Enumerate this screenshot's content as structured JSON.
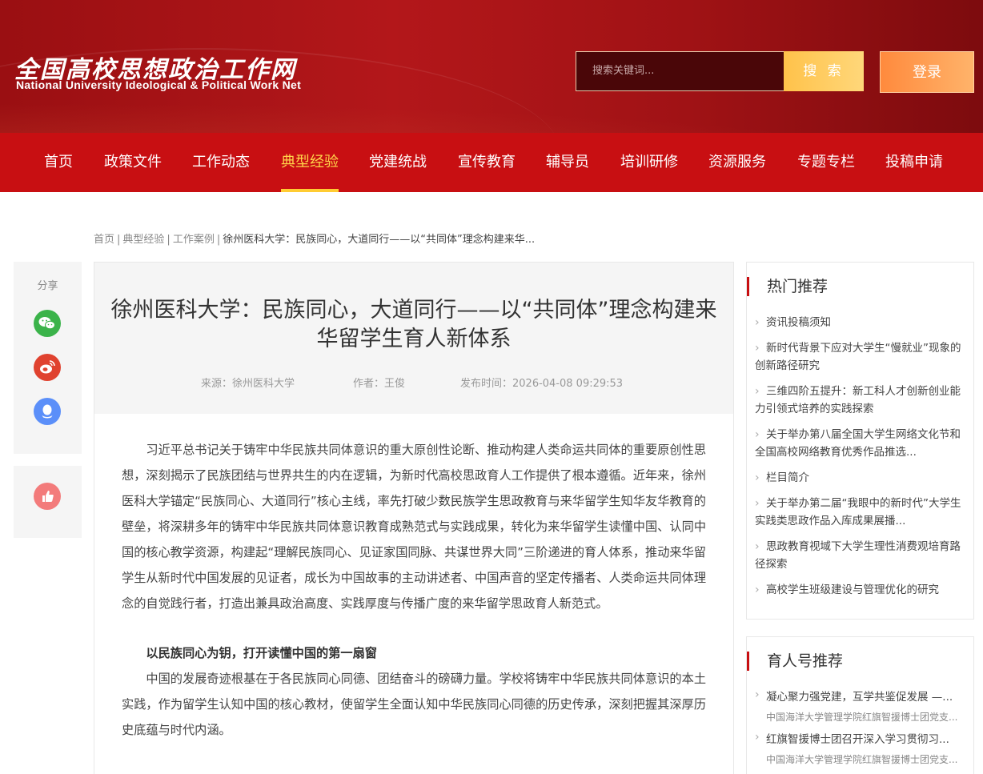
{
  "header": {
    "logo_cn": "全国高校思想政治工作网",
    "logo_en": "National University Ideological & Political Work Net",
    "search_placeholder": "搜索关键词...",
    "search_button": "搜 索",
    "login_button": "登录"
  },
  "nav": {
    "items": [
      "首页",
      "政策文件",
      "工作动态",
      "典型经验",
      "党建统战",
      "宣传教育",
      "辅导员",
      "培训研修",
      "资源服务",
      "专题专栏",
      "投稿申请"
    ],
    "active": "典型经验"
  },
  "breadcrumb": {
    "items": [
      "首页",
      "典型经验",
      "工作案例"
    ],
    "separator": "|",
    "current": "徐州医科大学：民族同心，大道同行——以“共同体”理念构建来华..."
  },
  "share": {
    "label": "分享",
    "icons": [
      "wechat-icon",
      "weibo-icon",
      "qq-icon"
    ],
    "like_icon": "thumbs-up-icon"
  },
  "article": {
    "title": "徐州医科大学：民族同心，大道同行——以“共同体”理念构建来华留学生育人新体系",
    "source": "来源：徐州医科大学",
    "author": "作者：王俊",
    "published": "发布时间：2026-04-08 09:29:53",
    "paragraphs": [
      "习近平总书记关于铸牢中华民族共同体意识的重大原创性论断、推动构建人类命运共同体的重要原创性思想，深刻揭示了民族团结与世界共生的内在逻辑，为新时代高校思政育人工作提供了根本遵循。近年来，徐州医科大学锚定“民族同心、大道同行”核心主线，率先打破少数民族学生思政教育与来华留学生知华友华教育的壁垒，将深耕多年的铸牢中华民族共同体意识教育成熟范式与实践成果，转化为来华留学生读懂中国、认同中国的核心教学资源，构建起“理解民族同心、见证家国同脉、共谋世界大同”三阶递进的育人体系，推动来华留学生从新时代中国发展的见证者，成长为中国故事的主动讲述者、中国声音的坚定传播者、人类命运共同体理念的自觉践行者，打造出兼具政治高度、实践厚度与传播广度的来华留学思政育人新范式。"
    ],
    "subheading": "以民族同心为钥，打开读懂中国的第一扇窗",
    "paragraph2": "中国的发展奇迹根基在于各民族同心同德、团结奋斗的磅礴力量。学校将铸牢中华民族共同体意识的本土实践，作为留学生认知中国的核心教材，使留学生全面认知中华民族同心同德的历史传承，深刻把握其深厚历史底蕴与时代内涵。"
  },
  "sidebar": {
    "hot_title": "热门推荐",
    "hot_items": [
      "资讯投稿须知",
      "新时代背景下应对大学生“慢就业”现象的创新路径研究",
      "三维四阶五提升：新工科人才创新创业能力引领式培养的实践探索",
      "关于举办第八届全国大学生网络文化节和全国高校网络教育优秀作品推选...",
      "栏目简介",
      "关于举办第二届“我眼中的新时代”大学生实践类思政作品入库成果展播...",
      "思政教育视域下大学生理性消费观培育路径探索",
      "高校学生班级建设与管理优化的研究"
    ],
    "yuren_title": "育人号推荐",
    "yuren_items": [
      {
        "title": "凝心聚力强党建，互学共鉴促发展 —...",
        "source": "中国海洋大学管理学院红旗智援博士团党支..."
      },
      {
        "title": "红旗智援博士团召开深入学习贯彻习...",
        "source": "中国海洋大学管理学院红旗智援博士团党支..."
      }
    ]
  },
  "colors": {
    "brand_red": "#c80f12",
    "nav_active": "#ffd54a",
    "search_button": "#ffc24a",
    "login_button": "#ff8a3d"
  }
}
